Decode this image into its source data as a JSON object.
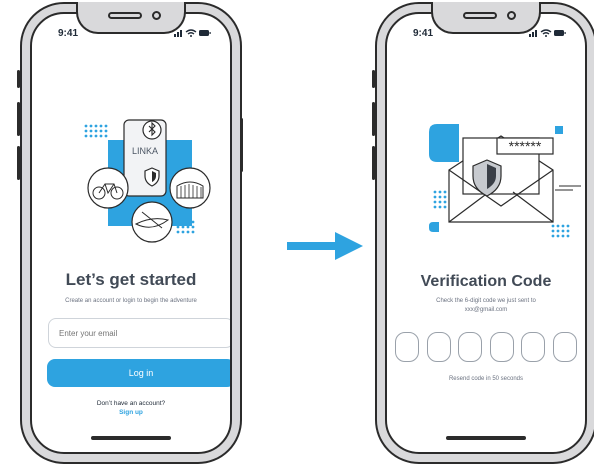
{
  "colors": {
    "accent": "#2ea3e0",
    "frame": "#2b2b2b",
    "text": "#414a56"
  },
  "login_screen": {
    "status_time": "9:41",
    "illustration_brand": "LINKA",
    "title": "Let’s get started",
    "subtitle": "Create an account or login to begin the adventure",
    "email_placeholder": "Enter your email",
    "login_label": "Log in",
    "no_account_text": "Don’t have an account?",
    "signup_label": "Sign up"
  },
  "verify_screen": {
    "status_time": "9:41",
    "password_mask": "******",
    "title": "Verification Code",
    "subtitle_line1": "Check the 6-digit code we just sent to",
    "subtitle_line2": "xxx@gmail.com",
    "code_digits": [
      "",
      "",
      "",
      "",
      "",
      ""
    ],
    "resend_text": "Resend code in 50 seconds"
  },
  "icons": [
    "signal-icon",
    "wifi-icon",
    "battery-icon",
    "bluetooth-icon",
    "shield-icon",
    "bicycle-icon",
    "gate-icon",
    "kayak-icon",
    "envelope-icon",
    "arrow-right-icon"
  ]
}
